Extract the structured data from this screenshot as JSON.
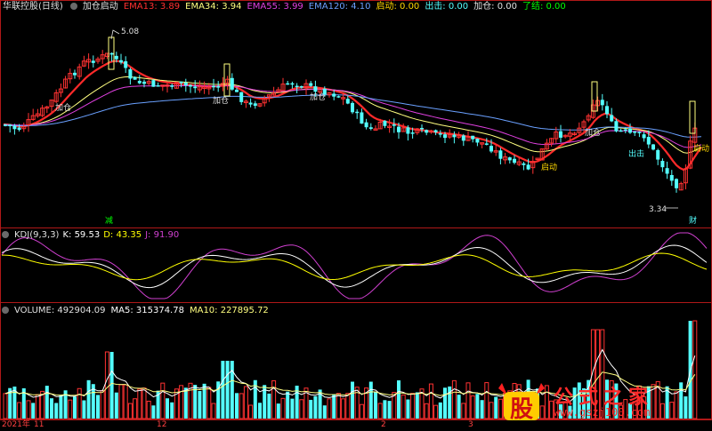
{
  "price_header": {
    "title": "华联控股(日线)",
    "indicator_name": "加仓启动",
    "ema13_label": "EMA13: 3.89",
    "ema34_label": "EMA34: 3.94",
    "ema55_label": "EMA55: 3.99",
    "ema120_label": "EMA120: 4.10",
    "qidong_label": "启动: 0.00",
    "chuji_label": "出击: 0.00",
    "jiacang_label": "加仓: 0.00",
    "lejie_label": "了结: 0.00"
  },
  "price_annotations": {
    "high": "5.08",
    "low": "3.34",
    "jiacang": "加仓",
    "qidong": "启动",
    "chuji": "出击",
    "jian": "减",
    "cai": "财"
  },
  "kdj_header": {
    "name": "KDJ(9,3,3)",
    "k": "K: 59.53",
    "d": "D: 43.35",
    "j": "J: 91.90"
  },
  "volume_header": {
    "name": "VOLUME: 492904.09",
    "ma5": "MA5: 315374.78",
    "ma10": "MA10: 227895.72"
  },
  "time_axis": [
    "2021年",
    "11",
    "12",
    "2",
    "3"
  ],
  "watermark": {
    "brand_char": "股",
    "title": "公式之家",
    "url": "www.gszj100.com"
  },
  "colors": {
    "up": "#ff3232",
    "down": "#54ffff",
    "ema13": "#ff2a2a",
    "ema34": "#ffff80",
    "ema55": "#e040e0",
    "ema120": "#6aa0ff",
    "kdj_k": "#ffffff",
    "kdj_d": "#ffff00",
    "kdj_j": "#d040d0"
  }
}
